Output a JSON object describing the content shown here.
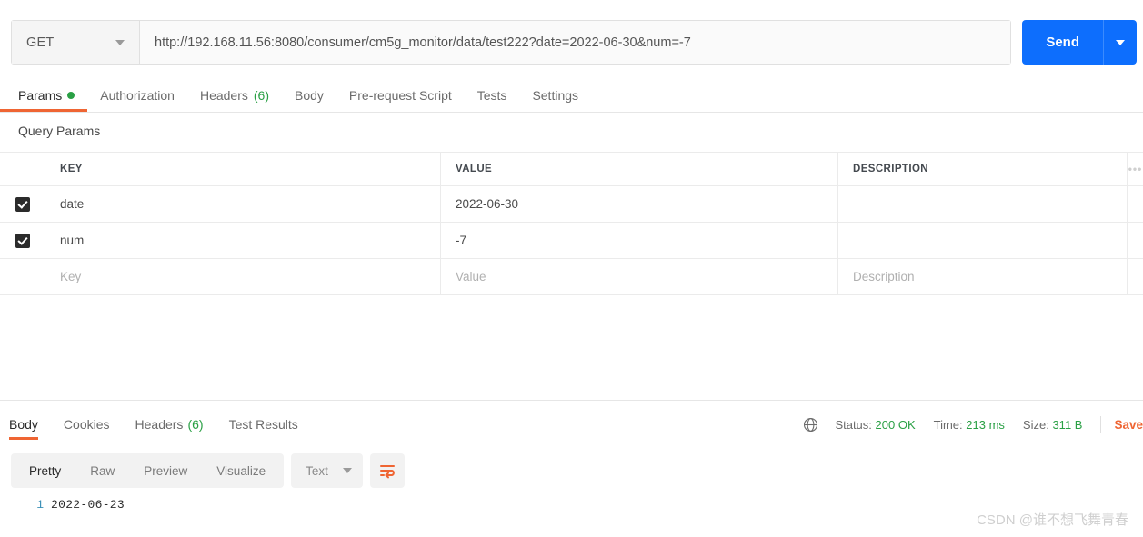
{
  "request": {
    "method": "GET",
    "url": "http://192.168.11.56:8080/consumer/cm5g_monitor/data/test222?date=2022-06-30&num=-7",
    "url_placeholder": "Enter request URL",
    "send_label": "Send"
  },
  "request_tabs": [
    {
      "label": "Params",
      "badge": "",
      "indicator": "dot",
      "active": true
    },
    {
      "label": "Authorization",
      "badge": "",
      "indicator": "",
      "active": false
    },
    {
      "label": "Headers",
      "badge": "(6)",
      "indicator": "",
      "active": false
    },
    {
      "label": "Body",
      "badge": "",
      "indicator": "",
      "active": false
    },
    {
      "label": "Pre-request Script",
      "badge": "",
      "indicator": "",
      "active": false
    },
    {
      "label": "Tests",
      "badge": "",
      "indicator": "",
      "active": false
    },
    {
      "label": "Settings",
      "badge": "",
      "indicator": "",
      "active": false
    }
  ],
  "query_params": {
    "section_title": "Query Params",
    "columns": [
      "KEY",
      "VALUE",
      "DESCRIPTION"
    ],
    "more_icon": "•••",
    "rows": [
      {
        "checked": true,
        "key": "date",
        "value": "2022-06-30",
        "description": ""
      },
      {
        "checked": true,
        "key": "num",
        "value": "-7",
        "description": ""
      }
    ],
    "empty_row": {
      "key_placeholder": "Key",
      "value_placeholder": "Value",
      "description_placeholder": "Description"
    }
  },
  "response": {
    "tabs": [
      {
        "label": "Body",
        "badge": "",
        "active": true
      },
      {
        "label": "Cookies",
        "badge": "",
        "active": false
      },
      {
        "label": "Headers",
        "badge": "(6)",
        "active": false
      },
      {
        "label": "Test Results",
        "badge": "",
        "active": false
      }
    ],
    "status": {
      "globe_icon": "globe-icon",
      "status_label": "Status:",
      "status_value": "200 OK",
      "time_label": "Time:",
      "time_value": "213 ms",
      "size_label": "Size:",
      "size_value": "311 B",
      "save_label": "Save"
    },
    "view_modes": [
      {
        "label": "Pretty",
        "active": true
      },
      {
        "label": "Raw",
        "active": false
      },
      {
        "label": "Preview",
        "active": false
      },
      {
        "label": "Visualize",
        "active": false
      }
    ],
    "format": {
      "selected": "Text",
      "wrap_icon": "word-wrap-icon"
    },
    "body_lines": [
      {
        "number": "1",
        "text": "2022-06-23"
      }
    ]
  },
  "watermark": "CSDN @谁不想飞舞青春",
  "colors": {
    "accent_orange": "#ef6533",
    "send_blue": "#0d6efd",
    "status_green": "#2aa045"
  }
}
